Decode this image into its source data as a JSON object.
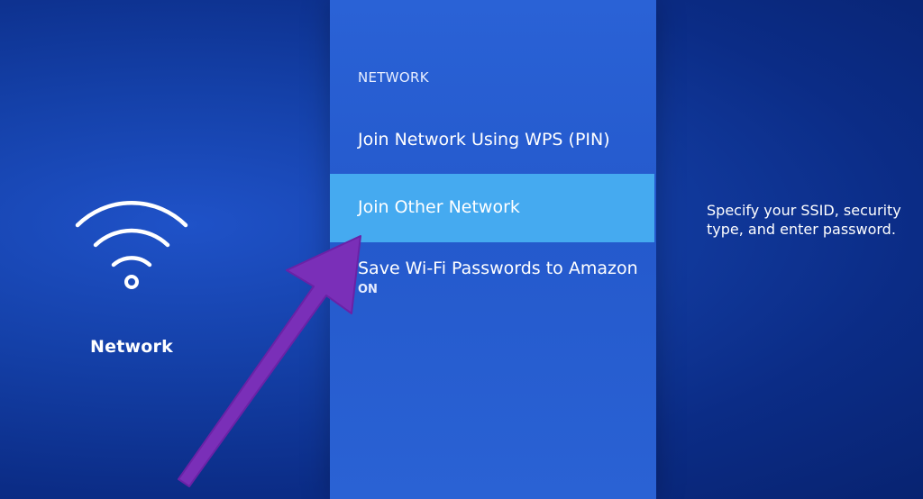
{
  "left": {
    "icon": "wifi-icon",
    "category_label": "Network"
  },
  "menu": {
    "header": "NETWORK",
    "items": [
      {
        "label": "Join Network Using WPS (PIN)"
      },
      {
        "label": "Join Other Network",
        "selected": true
      },
      {
        "label": "Save Wi-Fi Passwords to Amazon",
        "value": "ON"
      }
    ]
  },
  "description": "Specify your SSID, security type, and enter password.",
  "colors": {
    "background": "#0b2c86",
    "menu_panel": "#2459cc",
    "selected_item": "#45aaf0",
    "annotation_arrow": "#7a2fb8"
  },
  "overlay": {
    "icon": "pointer-arrow-icon"
  }
}
